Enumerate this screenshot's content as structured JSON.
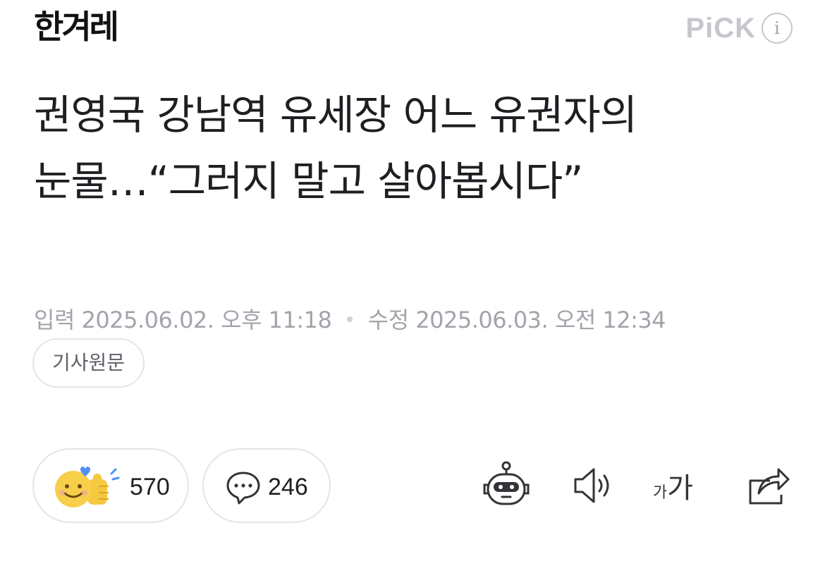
{
  "press": {
    "logo_text": "한겨레",
    "pick_label": "PiCK",
    "info_icon": "info-icon",
    "info_glyph": "i"
  },
  "article": {
    "headline": "권영국 강남역 유세장 어느 유권자의 눈물…“그러지 말고 살아봅시다”",
    "input_label": "입력",
    "input_time": "2025.06.02. 오후 11:18",
    "edit_label": "수정",
    "edit_time": "2025.06.03. 오전 12:34",
    "original_button": "기사원문"
  },
  "actions": {
    "reaction_icon": "smiley-thumbs-up-icon",
    "reaction_count": "570",
    "comment_icon": "speech-bubble-icon",
    "comment_count": "246",
    "tools": [
      {
        "icon": "summary-bot-icon"
      },
      {
        "icon": "speaker-icon"
      },
      {
        "icon": "font-size-icon",
        "small": "가",
        "big": "가"
      },
      {
        "icon": "share-icon"
      }
    ]
  },
  "colors": {
    "text": "#1e1e23",
    "muted": "#a1a4aa",
    "border": "#e4e5e8",
    "reaction_yellow": "#f7cf4b",
    "reaction_blue": "#4f8ff7"
  }
}
